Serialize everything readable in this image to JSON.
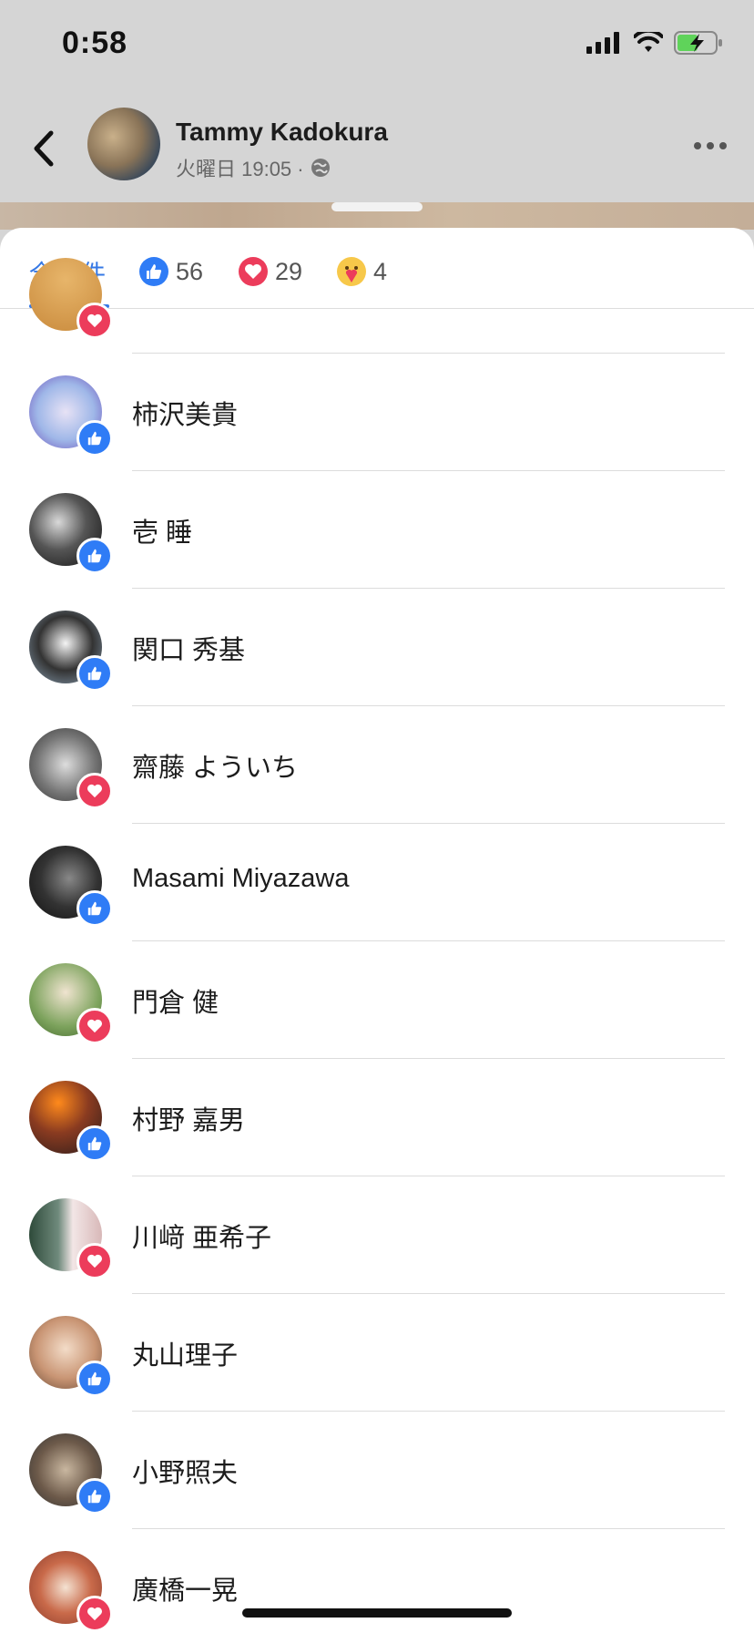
{
  "status_bar": {
    "time": "0:58",
    "signal_icon": "signal-bars-icon",
    "wifi_icon": "wifi-icon",
    "battery_icon": "battery-charging-icon"
  },
  "post": {
    "author": "Tammy Kadokura",
    "meta": "火曜日 19:05 ·",
    "privacy_icon": "globe-icon",
    "back_icon": "chevron-left-icon",
    "more_icon": "more-dots-icon"
  },
  "tabs": [
    {
      "label": "全89件",
      "icon": ""
    },
    {
      "label": "56",
      "icon": "like-icon"
    },
    {
      "label": "29",
      "icon": "love-icon"
    },
    {
      "label": "4",
      "icon": "care-icon"
    }
  ],
  "reactors": [
    {
      "name": "",
      "reaction": "love"
    },
    {
      "name": "柿沢美貴",
      "reaction": "like"
    },
    {
      "name": "壱 睡",
      "reaction": "like"
    },
    {
      "name": "関口 秀基",
      "reaction": "like"
    },
    {
      "name": "齋藤 よういち",
      "reaction": "love"
    },
    {
      "name": "Masami  Miyazawa",
      "reaction": "like"
    },
    {
      "name": "門倉 健",
      "reaction": "love"
    },
    {
      "name": "村野 嘉男",
      "reaction": "like"
    },
    {
      "name": "川﨑 亜希子",
      "reaction": "love"
    },
    {
      "name": "丸山理子",
      "reaction": "like"
    },
    {
      "name": "小野照夫",
      "reaction": "like"
    },
    {
      "name": "廣橋一晃",
      "reaction": "love"
    }
  ],
  "colors": {
    "accent": "#3578e5",
    "like": "#2f7cf6",
    "love": "#ec3c5b",
    "care": "#f7c84a"
  }
}
